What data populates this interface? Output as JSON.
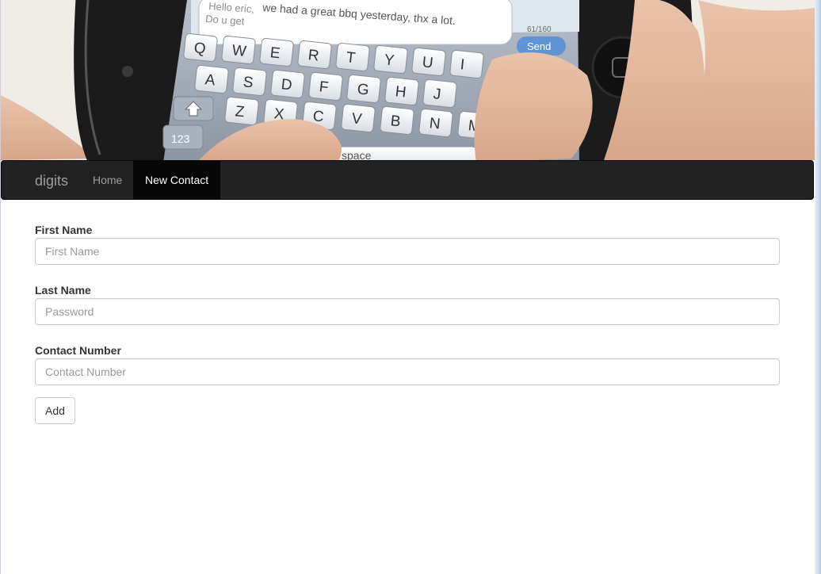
{
  "hero": {
    "phone_screen_text": "we had a great bbq yesterday, thx a lot.",
    "phone_screen_partial": "Hello eric,",
    "phone_screen_reply": "Do u get",
    "counter": "61/160",
    "send_button": "Send",
    "keyboard_rows": [
      [
        "Q",
        "W",
        "E",
        "R",
        "T",
        "Y",
        "U",
        "I"
      ],
      [
        "A",
        "S",
        "D",
        "F",
        "G",
        "H",
        "J"
      ],
      [
        "Z",
        "X",
        "C",
        "V",
        "B",
        "N",
        "M"
      ]
    ],
    "num_key": "123",
    "space_key": "space"
  },
  "navbar": {
    "brand": "digits",
    "items": [
      {
        "label": "Home",
        "active": false
      },
      {
        "label": "New Contact",
        "active": true
      }
    ]
  },
  "form": {
    "fields": [
      {
        "label": "First Name",
        "placeholder": "First Name",
        "value": ""
      },
      {
        "label": "Last Name",
        "placeholder": "Password",
        "value": ""
      },
      {
        "label": "Contact Number",
        "placeholder": "Contact Number",
        "value": ""
      }
    ],
    "submit_label": "Add"
  },
  "colors": {
    "navbar_bg": "#222222",
    "navbar_active_bg": "#080808",
    "nav_text": "#9d9d9d",
    "input_border": "#cccccc"
  }
}
